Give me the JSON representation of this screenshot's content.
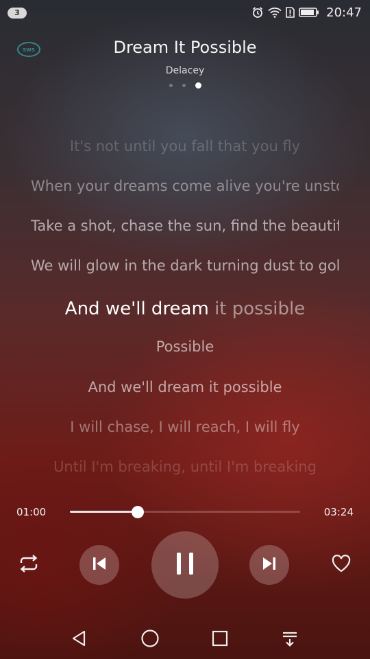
{
  "status_bar": {
    "notification_count": "3",
    "time": "20:47",
    "icons": [
      "alarm-icon",
      "wifi-icon",
      "sim-alert-icon",
      "battery-icon"
    ]
  },
  "header": {
    "logo_text": "SWS",
    "title": "Dream It Possible",
    "artist": "Delacey",
    "page_count": 3,
    "active_page": 3
  },
  "lyrics": {
    "lines": [
      "It's not until you fall that you fly",
      "When your dreams come alive you're unstoppable",
      "Take a shot, chase the sun, find the beautiful",
      "We will glow in the dark turning dust to gold",
      "Possible",
      "And we'll dream it possible",
      "I will chase, I will reach, I will fly",
      "Until I'm breaking, until I'm breaking"
    ],
    "current_line_sung": "And we'll dream",
    "current_line_remaining": " it possible"
  },
  "player": {
    "current_time": "01:00",
    "total_time": "03:24",
    "progress": 0.294
  },
  "controls": {
    "repeat": "repeat-icon",
    "previous": "skip-previous-icon",
    "play_pause": "pause-icon",
    "next": "skip-next-icon",
    "favorite": "heart-outline-icon"
  },
  "nav_bar": {
    "icons": [
      "back-triangle-icon",
      "home-circle-icon",
      "recents-square-icon",
      "notification-pull-icon"
    ]
  },
  "colors": {
    "accent": "#ffffff",
    "background_top": "#2a2c33",
    "background_bottom": "#6e1c18"
  }
}
